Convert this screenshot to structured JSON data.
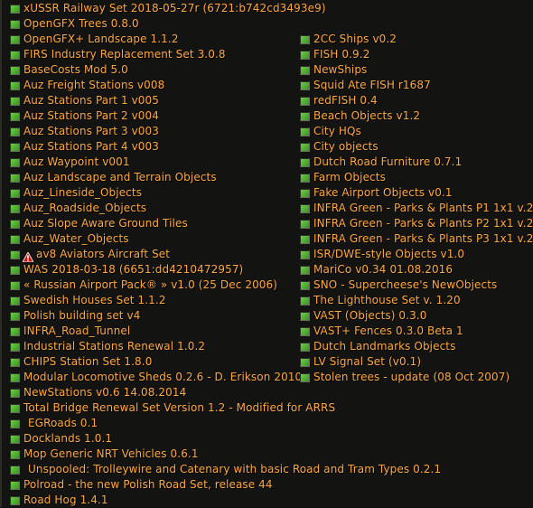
{
  "window": {
    "title": "NewGRF Settings — active list",
    "background_color": "#131311",
    "text_color": "#ffa83c",
    "checkbox_color": "#4fa832",
    "warning_color": "#d01414"
  },
  "icons": {
    "checkbox_enabled": "checkbox-checked-icon",
    "warning": "warning-triangle-icon"
  },
  "columns": [
    {
      "id": "left",
      "items": [
        {
          "label": "xUSSR Railway Set 2018-05-27r (6721:b742cd3493e9)",
          "enabled": true,
          "warning": false,
          "indent": false
        },
        {
          "label": "OpenGFX Trees 0.8.0",
          "enabled": true,
          "warning": false,
          "indent": false
        },
        {
          "label": "OpenGFX+ Landscape 1.1.2",
          "enabled": true,
          "warning": false,
          "indent": false
        },
        {
          "label": "FIRS Industry Replacement Set 3.0.8",
          "enabled": true,
          "warning": false,
          "indent": false
        },
        {
          "label": "BaseCosts Mod 5.0",
          "enabled": true,
          "warning": false,
          "indent": false
        },
        {
          "label": "Auz Freight Stations v008",
          "enabled": true,
          "warning": false,
          "indent": false
        },
        {
          "label": "Auz Stations Part 1 v005",
          "enabled": true,
          "warning": false,
          "indent": false
        },
        {
          "label": "Auz Stations Part 2 v004",
          "enabled": true,
          "warning": false,
          "indent": false
        },
        {
          "label": "Auz Stations Part 3 v003",
          "enabled": true,
          "warning": false,
          "indent": false
        },
        {
          "label": "Auz Stations Part 4 v003",
          "enabled": true,
          "warning": false,
          "indent": false
        },
        {
          "label": "Auz Waypoint v001",
          "enabled": true,
          "warning": false,
          "indent": false
        },
        {
          "label": "Auz Landscape and Terrain Objects",
          "enabled": true,
          "warning": false,
          "indent": false
        },
        {
          "label": "Auz_Lineside_Objects",
          "enabled": true,
          "warning": false,
          "indent": false
        },
        {
          "label": "Auz_Roadside_Objects",
          "enabled": true,
          "warning": false,
          "indent": false
        },
        {
          "label": "Auz Slope Aware Ground Tiles",
          "enabled": true,
          "warning": false,
          "indent": false
        },
        {
          "label": "Auz_Water_Objects",
          "enabled": true,
          "warning": false,
          "indent": false
        },
        {
          "label": "av8 Aviators Aircraft Set",
          "enabled": true,
          "warning": true,
          "indent": false
        },
        {
          "label": "WAS 2018-03-18 (6651:dd4210472957)",
          "enabled": true,
          "warning": false,
          "indent": false
        },
        {
          "label": "« Russian Airport Pack® »  v1.0 (25 Dec 2006)",
          "enabled": true,
          "warning": false,
          "indent": false
        },
        {
          "label": "Swedish Houses Set 1.1.2",
          "enabled": true,
          "warning": false,
          "indent": false
        },
        {
          "label": "Polish building set v4",
          "enabled": true,
          "warning": false,
          "indent": false
        },
        {
          "label": "INFRA_Road_Tunnel",
          "enabled": true,
          "warning": false,
          "indent": false
        },
        {
          "label": "Industrial Stations Renewal 1.0.2",
          "enabled": true,
          "warning": false,
          "indent": false
        },
        {
          "label": "CHIPS Station Set 1.8.0",
          "enabled": true,
          "warning": false,
          "indent": false
        },
        {
          "label": "Modular Locomotive Sheds 0.2.6 - D. Erikson 2010",
          "enabled": true,
          "warning": false,
          "indent": false
        },
        {
          "label": "NewStations v0.6 14.08.2014",
          "enabled": true,
          "warning": false,
          "indent": false
        },
        {
          "label": "Total Bridge Renewal Set Version 1.2 - Modified for ARRS",
          "enabled": true,
          "warning": false,
          "indent": false
        },
        {
          "label": "EGRoads 0.1",
          "enabled": true,
          "warning": false,
          "indent": true
        },
        {
          "label": "Docklands 1.0.1",
          "enabled": true,
          "warning": false,
          "indent": false
        },
        {
          "label": "Mop Generic NRT Vehicles 0.6.1",
          "enabled": true,
          "warning": false,
          "indent": false
        },
        {
          "label": "Unspooled: Trolleywire and Catenary with basic Road and Tram Types 0.2.1",
          "enabled": true,
          "warning": false,
          "indent": true
        },
        {
          "label": "Polroad - the new Polish Road Set, release 44",
          "enabled": true,
          "warning": false,
          "indent": false
        },
        {
          "label": "Road Hog 1.4.1",
          "enabled": true,
          "warning": false,
          "indent": false
        }
      ]
    },
    {
      "id": "right",
      "items": [
        {
          "label": "2CC Ships v0.2",
          "enabled": true,
          "warning": false,
          "indent": false
        },
        {
          "label": "FISH 0.9.2",
          "enabled": true,
          "warning": false,
          "indent": false
        },
        {
          "label": "NewShips",
          "enabled": true,
          "warning": false,
          "indent": false
        },
        {
          "label": "Squid Ate FISH r1687",
          "enabled": true,
          "warning": false,
          "indent": false
        },
        {
          "label": "redFISH 0.4",
          "enabled": true,
          "warning": false,
          "indent": false
        },
        {
          "label": "Beach Objects v1.2",
          "enabled": true,
          "warning": false,
          "indent": false
        },
        {
          "label": "City HQs",
          "enabled": true,
          "warning": false,
          "indent": false
        },
        {
          "label": "City objects",
          "enabled": true,
          "warning": false,
          "indent": false
        },
        {
          "label": "Dutch Road Furniture 0.7.1",
          "enabled": true,
          "warning": false,
          "indent": false
        },
        {
          "label": "Farm Objects",
          "enabled": true,
          "warning": false,
          "indent": false
        },
        {
          "label": "Fake Airport Objects v0.1",
          "enabled": true,
          "warning": false,
          "indent": false
        },
        {
          "label": "INFRA Green - Parks & Plants P1 1x1 v.2",
          "enabled": true,
          "warning": false,
          "indent": false
        },
        {
          "label": "INFRA Green - Parks & Plants P2 1x1 v.2",
          "enabled": true,
          "warning": false,
          "indent": false
        },
        {
          "label": "INFRA Green - Parks & Plants P3 1x1 v.2",
          "enabled": true,
          "warning": false,
          "indent": false
        },
        {
          "label": "ISR/DWE-style Objects v1.0",
          "enabled": true,
          "warning": false,
          "indent": false
        },
        {
          "label": "MariCo v0.34 01.08.2016",
          "enabled": true,
          "warning": false,
          "indent": false
        },
        {
          "label": "SNO - Supercheese's NewObjects",
          "enabled": true,
          "warning": false,
          "indent": false
        },
        {
          "label": "The Lighthouse Set v. 1.20",
          "enabled": true,
          "warning": false,
          "indent": false
        },
        {
          "label": "VAST (Objects) 0.3.0",
          "enabled": true,
          "warning": false,
          "indent": false
        },
        {
          "label": "VAST+ Fences 0.3.0 Beta 1",
          "enabled": true,
          "warning": false,
          "indent": false
        },
        {
          "label": "Dutch Landmarks Objects",
          "enabled": true,
          "warning": false,
          "indent": false
        },
        {
          "label": "LV Signal Set (v0.1)",
          "enabled": true,
          "warning": false,
          "indent": false
        },
        {
          "label": "Stolen trees - update (08 Oct 2007)",
          "enabled": true,
          "warning": false,
          "indent": false
        }
      ]
    }
  ]
}
